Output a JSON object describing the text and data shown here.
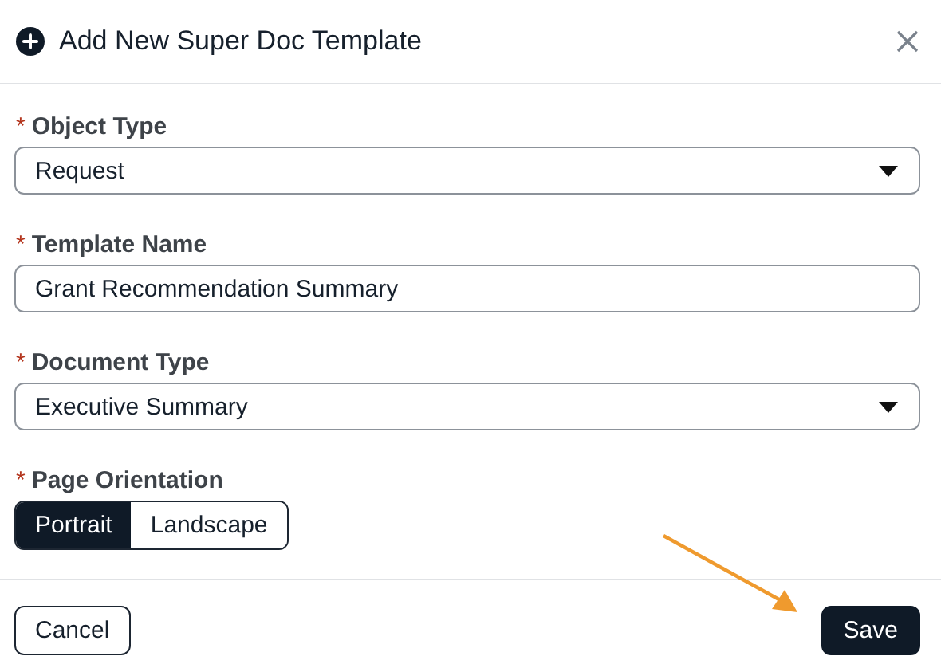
{
  "dialog": {
    "title": "Add New Super Doc Template"
  },
  "fields": [
    {
      "label": "Object Type",
      "required_mark": "*",
      "kind": "select",
      "value": "Request"
    },
    {
      "label": "Template Name",
      "required_mark": "*",
      "kind": "text",
      "value": "Grant Recommendation Summary"
    },
    {
      "label": "Document Type",
      "required_mark": "*",
      "kind": "select",
      "value": "Executive Summary"
    },
    {
      "label": "Page Orientation",
      "required_mark": "*",
      "kind": "segmented",
      "options": [
        {
          "label": "Portrait",
          "selected": true
        },
        {
          "label": "Landscape",
          "selected": false
        }
      ]
    }
  ],
  "buttons": [
    {
      "label": "Cancel",
      "kind": "secondary"
    },
    {
      "label": "Save",
      "kind": "primary"
    }
  ]
}
